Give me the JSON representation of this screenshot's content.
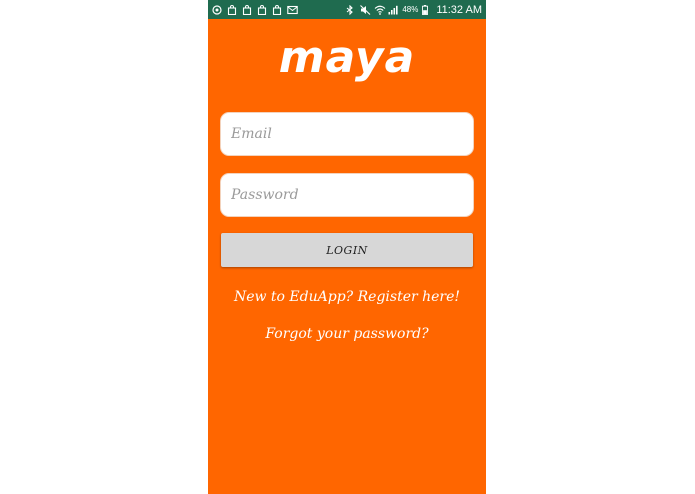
{
  "colors": {
    "background": "#ff6600",
    "statusbar": "#1f6b4f",
    "button": "#d7d7d7",
    "text_light": "#ffffff"
  },
  "statusbar": {
    "left_icons": [
      "sync-icon",
      "bag-icon",
      "bag-icon",
      "bag-icon",
      "bag-icon",
      "mail-icon"
    ],
    "right_icons": [
      "bluetooth-icon",
      "mute-icon",
      "wifi-icon",
      "signal-icon",
      "battery-icon"
    ],
    "battery_percent": "48%",
    "time": "11:32 AM"
  },
  "app": {
    "logo_text": "maya"
  },
  "login_form": {
    "email_placeholder": "Email",
    "password_placeholder": "Password",
    "login_label": "LOGIN",
    "register_link": "New to EduApp? Register here!",
    "forgot_link": "Forgot your password?"
  }
}
